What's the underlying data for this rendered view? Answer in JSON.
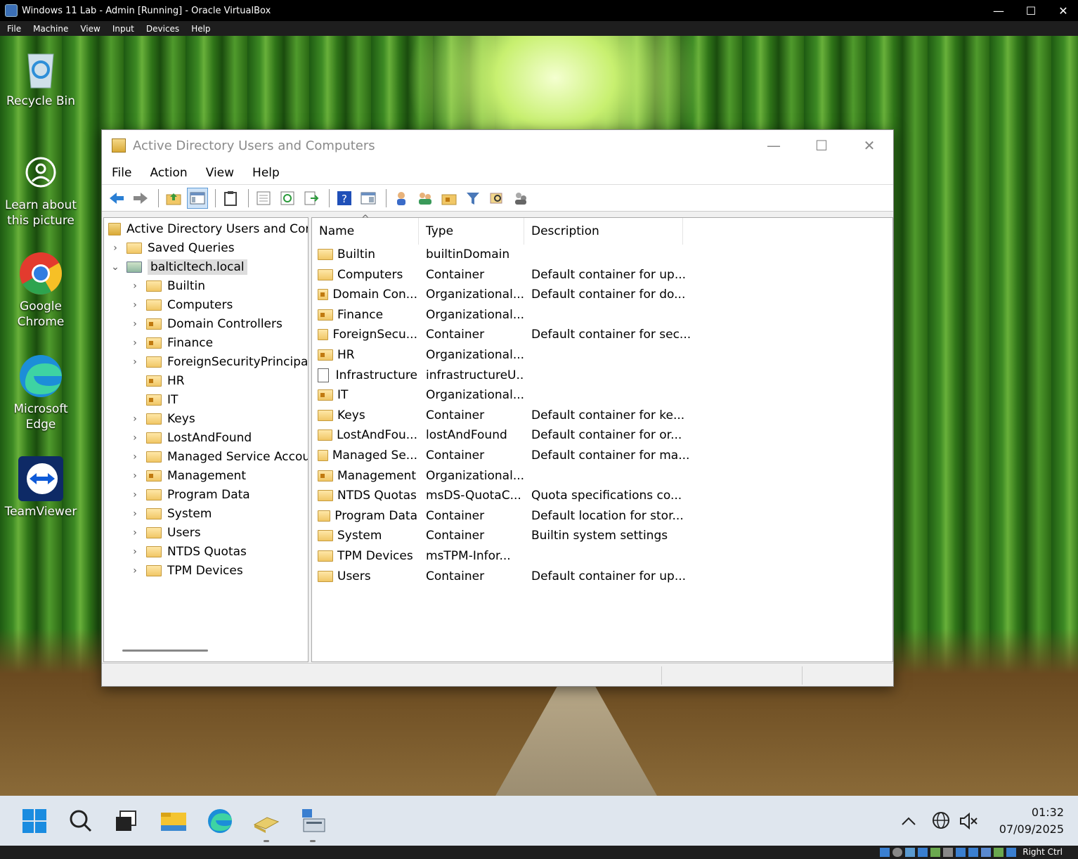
{
  "vbox": {
    "title": "Windows 11 Lab - Admin [Running] - Oracle VirtualBox",
    "menu": [
      "File",
      "Machine",
      "View",
      "Input",
      "Devices",
      "Help"
    ],
    "host_key": "Right Ctrl"
  },
  "desktop": {
    "icons": [
      {
        "label": "Recycle Bin",
        "icon": "recycle-bin-icon"
      },
      {
        "label": "Learn about this picture",
        "icon": "camera-icon"
      },
      {
        "label": "Google Chrome",
        "icon": "chrome-icon"
      },
      {
        "label": "Microsoft Edge",
        "icon": "edge-icon"
      },
      {
        "label": "TeamViewer",
        "icon": "teamviewer-icon"
      }
    ]
  },
  "window": {
    "title": "Active Directory Users and Computers",
    "menu": [
      "File",
      "Action",
      "View",
      "Help"
    ],
    "tree": {
      "root": "Active Directory Users and Com",
      "saved": "Saved Queries",
      "domain": "balticltech.local",
      "children": [
        "Builtin",
        "Computers",
        "Domain Controllers",
        "Finance",
        "ForeignSecurityPrincipal:",
        "HR",
        "IT",
        "Keys",
        "LostAndFound",
        "Managed Service Accour",
        "Management",
        "Program Data",
        "System",
        "Users",
        "NTDS Quotas",
        "TPM Devices"
      ]
    },
    "columns": {
      "name": "Name",
      "type": "Type",
      "description": "Description"
    },
    "rows": [
      {
        "name": "Builtin",
        "type": "builtinDomain",
        "desc": ""
      },
      {
        "name": "Computers",
        "type": "Container",
        "desc": "Default container for up..."
      },
      {
        "name": "Domain Con...",
        "type": "Organizational...",
        "desc": "Default container for do..."
      },
      {
        "name": "Finance",
        "type": "Organizational...",
        "desc": ""
      },
      {
        "name": "ForeignSecu...",
        "type": "Container",
        "desc": "Default container for sec..."
      },
      {
        "name": "HR",
        "type": "Organizational...",
        "desc": ""
      },
      {
        "name": "Infrastructure",
        "type": "infrastructureU...",
        "desc": ""
      },
      {
        "name": "IT",
        "type": "Organizational...",
        "desc": ""
      },
      {
        "name": "Keys",
        "type": "Container",
        "desc": "Default container for ke..."
      },
      {
        "name": "LostAndFou...",
        "type": "lostAndFound",
        "desc": "Default container for or..."
      },
      {
        "name": "Managed Se...",
        "type": "Container",
        "desc": "Default container for ma..."
      },
      {
        "name": "Management",
        "type": "Organizational...",
        "desc": ""
      },
      {
        "name": "NTDS Quotas",
        "type": "msDS-QuotaC...",
        "desc": "Quota specifications co..."
      },
      {
        "name": "Program Data",
        "type": "Container",
        "desc": "Default location for stor..."
      },
      {
        "name": "System",
        "type": "Container",
        "desc": "Builtin system settings"
      },
      {
        "name": "TPM Devices",
        "type": "msTPM-Infor...",
        "desc": ""
      },
      {
        "name": "Users",
        "type": "Container",
        "desc": "Default container for up..."
      }
    ]
  },
  "taskbar": {
    "time": "01:32",
    "date": "07/09/2025"
  }
}
